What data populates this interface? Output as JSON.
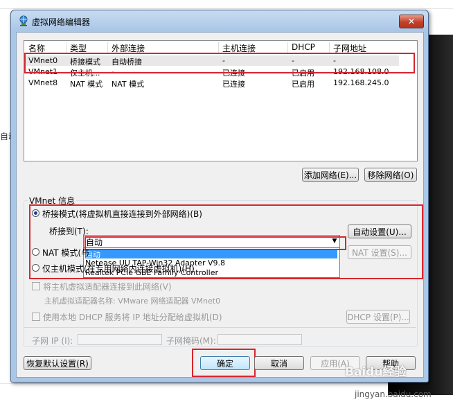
{
  "background": {
    "side_text": "自动"
  },
  "window": {
    "title": "虚拟网络编辑器",
    "close_label": "✕"
  },
  "netlist": {
    "headers": [
      "名称",
      "类型",
      "外部连接",
      "主机连接",
      "DHCP",
      "子网地址"
    ],
    "rows": [
      [
        "VMnet0",
        "桥接模式",
        "自动桥接",
        "-",
        "-",
        "-"
      ],
      [
        "VMnet1",
        "仅主机...",
        "-",
        "已连接",
        "已启用",
        "192.168.108.0"
      ],
      [
        "VMnet8",
        "NAT 模式",
        "NAT 模式",
        "已连接",
        "已启用",
        "192.168.245.0"
      ]
    ]
  },
  "list_buttons": {
    "add": "添加网络(E)...",
    "remove": "移除网络(O)"
  },
  "vmnet_info": {
    "group_title": "VMnet 信息",
    "bridge_mode": "桥接模式(将虚拟机直接连接到外部网络)(B)",
    "bridge_to_label": "桥接到(T):",
    "bridge_to_value": "自动",
    "auto_settings": "自动设置(U)...",
    "dropdown_options": [
      "自动",
      "Netease UU TAP-Win32 Adapter V9.8",
      "Realtek PCIe GBE Family Controller"
    ],
    "nat_mode": "NAT 模式(与",
    "nat_settings": "NAT 设置(S)...",
    "host_only_mode": "仅主机模式(在专用网络内连接虚拟机)(H)",
    "connect_adapter": "将主机虚拟适配器连接到此网络(V)",
    "adapter_name": "主机虚拟适配器名称: VMware 网络适配器 VMnet0",
    "use_dhcp": "使用本地 DHCP 服务将 IP 地址分配给虚拟机(D)",
    "dhcp_settings": "DHCP 设置(P)...",
    "subnet_ip": "子网 IP (I):",
    "subnet_mask": "子网掩码(M):"
  },
  "footer": {
    "restore": "恢复默认设置(R)",
    "ok": "确定",
    "cancel": "取消",
    "apply": "应用(A)",
    "help": "帮助"
  },
  "watermark": {
    "brand": "Baidu经验",
    "url": "jingyan.baidu.com"
  },
  "colors": {
    "highlight_red": "#d6262d",
    "selection_blue": "#3399ff",
    "title_blue": "#a9c6e6"
  }
}
